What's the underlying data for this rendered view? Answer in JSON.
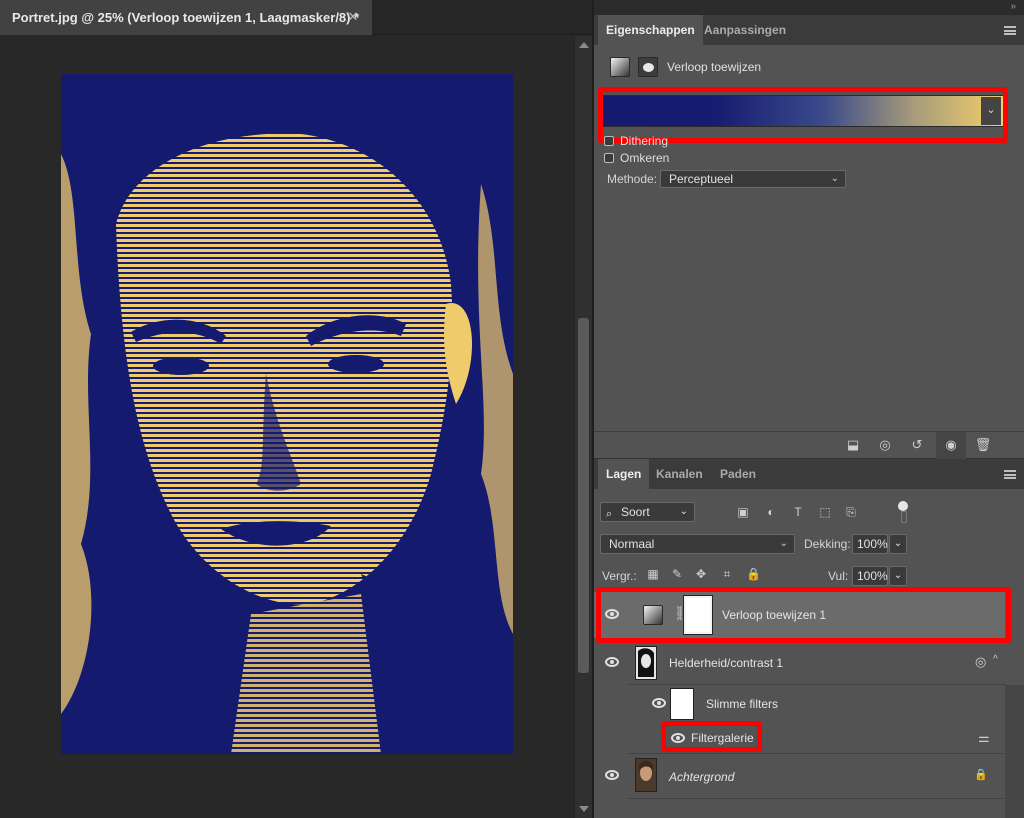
{
  "document": {
    "tab_title": "Portret.jpg @ 25% (Verloop toewijzen 1, Laagmasker/8) *",
    "close_glyph": "✕",
    "gradient_colors": {
      "dark": "#141a6e",
      "light": "#f0cb6c"
    }
  },
  "top_strip": {
    "collapse_glyph": "»"
  },
  "properties": {
    "tabs": [
      "Eigenschappen",
      "Aanpassingen"
    ],
    "title": "Verloop toewijzen",
    "dither_label": "Dithering",
    "reverse_label": "Omkeren",
    "method_label": "Methode:",
    "method_value": "Perceptueel",
    "gradient": {
      "from": "#131a70",
      "to": "#f4d06a"
    },
    "bottom_icons": [
      "clip-to-layer-icon",
      "view-previous-icon",
      "reset-icon",
      "visibility-icon",
      "trash-icon"
    ]
  },
  "layers": {
    "tabs": [
      "Lagen",
      "Kanalen",
      "Paden"
    ],
    "filter_kind": "Soort",
    "blend_mode": "Normaal",
    "opacity_label": "Dekking:",
    "opacity_value": "100%",
    "lock_label": "Vergr.:",
    "fill_label": "Vul:",
    "fill_value": "100%",
    "items": [
      {
        "name": "Verloop toewijzen 1"
      },
      {
        "name": "Helderheid/contrast 1"
      },
      {
        "name": "Slimme filters"
      },
      {
        "name": "Filtergalerie"
      },
      {
        "name": "Achtergrond"
      }
    ]
  },
  "accent": {
    "highlight_red": "#ff0000"
  }
}
